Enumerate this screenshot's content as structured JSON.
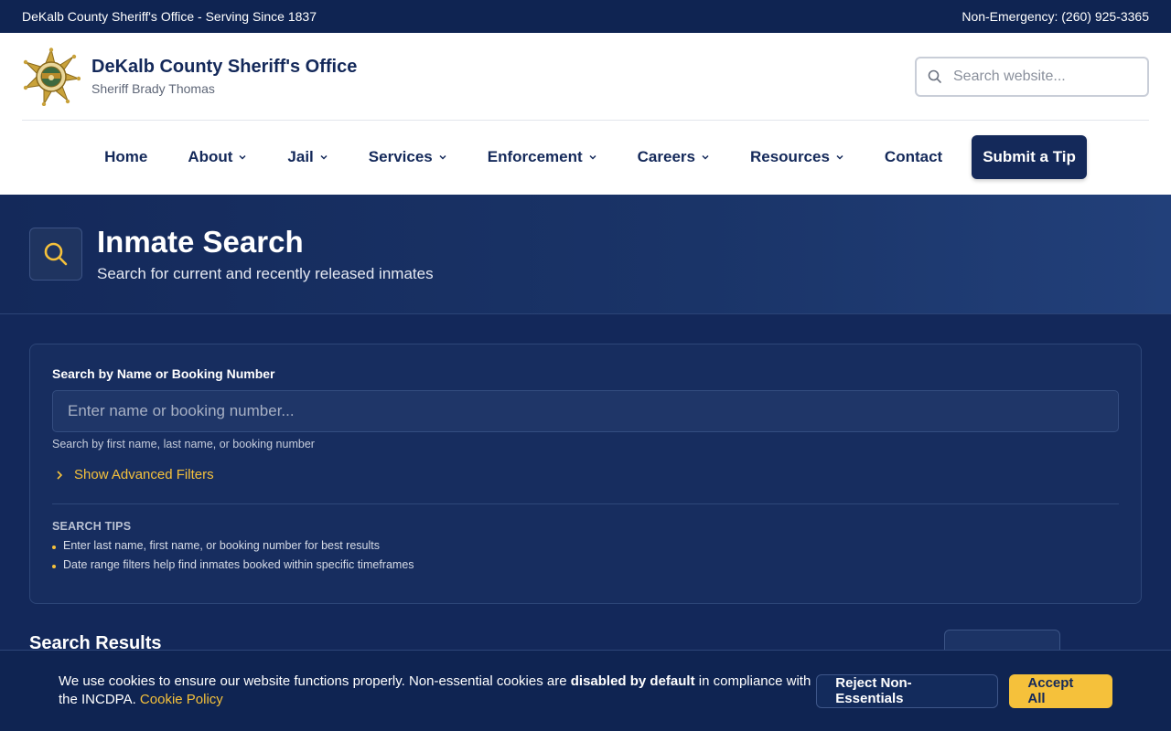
{
  "topbar": {
    "left": "DeKalb County Sheriff's Office - Serving Since 1837",
    "right": "Non-Emergency: (260) 925-3365"
  },
  "brand": {
    "title": "DeKalb County Sheriff's Office",
    "subtitle": "Sheriff Brady Thomas",
    "badge_icon": "sheriff-star-badge"
  },
  "site_search": {
    "placeholder": "Search website..."
  },
  "nav": {
    "items": [
      {
        "label": "Home",
        "dropdown": false
      },
      {
        "label": "About",
        "dropdown": true
      },
      {
        "label": "Jail",
        "dropdown": true
      },
      {
        "label": "Services",
        "dropdown": true
      },
      {
        "label": "Enforcement",
        "dropdown": true
      },
      {
        "label": "Careers",
        "dropdown": true
      },
      {
        "label": "Resources",
        "dropdown": true
      },
      {
        "label": "Contact",
        "dropdown": false
      }
    ],
    "cta": "Submit a Tip"
  },
  "hero": {
    "title": "Inmate Search",
    "subtitle": "Search for current and recently released inmates"
  },
  "search_card": {
    "label": "Search by Name or Booking Number",
    "placeholder": "Enter name or booking number...",
    "hint": "Search by first name, last name, or booking number",
    "advanced_toggle": "Show Advanced Filters",
    "tips_title": "SEARCH TIPS",
    "tips": [
      "Enter last name, first name, or booking number for best results",
      "Date range filters help find inmates booked within specific timeframes"
    ]
  },
  "results": {
    "title": "Search Results"
  },
  "cookie": {
    "text_before": "We use cookies to ensure our website functions properly. Non-essential cookies are ",
    "text_bold": "disabled by default",
    "text_after": " in compliance with the INCDPA. ",
    "link": "Cookie Policy",
    "reject": "Reject Non-Essentials",
    "accept": "Accept All"
  },
  "colors": {
    "navy": "#14295a",
    "gold": "#f5c13b",
    "topbar": "#0f2452"
  }
}
